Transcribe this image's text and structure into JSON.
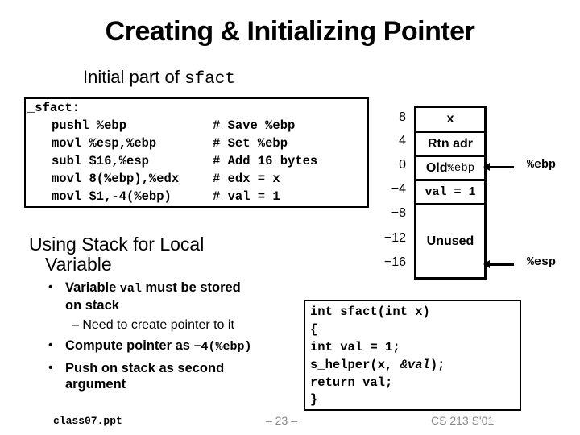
{
  "slide": {
    "title": "Creating & Initializing Pointer",
    "subtitle_prefix": "Initial part of ",
    "subtitle_code": "sfact"
  },
  "assembly": {
    "label": "_sfact:",
    "lines": [
      {
        "instr": "pushl %ebp",
        "comment": "# Save %ebp"
      },
      {
        "instr": "movl %esp,%ebp",
        "comment": "# Set %ebp"
      },
      {
        "instr": "subl $16,%esp",
        "comment": "# Add 16 bytes"
      },
      {
        "instr": "movl 8(%ebp),%edx",
        "comment": "# edx = x"
      },
      {
        "instr": "movl $1,-4(%ebp)",
        "comment": "# val = 1"
      }
    ]
  },
  "stack": {
    "offsets": [
      "8",
      "4",
      "0",
      "−4",
      "−8",
      "−12",
      "−16"
    ],
    "cells": [
      {
        "label": "x"
      },
      {
        "label": "Rtn adr"
      },
      {
        "label_prefix": "Old ",
        "label_code": "%ebp"
      },
      {
        "label": "val = 1"
      },
      {
        "label": "Unused"
      }
    ],
    "registers": [
      {
        "name": "%ebp",
        "points_to_offset": "0"
      },
      {
        "name": "%esp",
        "points_to_offset": "-16"
      }
    ]
  },
  "section": {
    "heading_line1": "Using Stack for Local",
    "heading_line2": "Variable",
    "bullets": [
      {
        "dot": "•",
        "text_a": "Variable ",
        "code": "val",
        "text_b": " must be stored",
        "text_c": "on stack"
      },
      {
        "dot": "•",
        "text_a": "Compute pointer as ",
        "code": "−4(%ebp)"
      },
      {
        "dot": "•",
        "text_a": "Push on stack as second",
        "text_c": "argument"
      }
    ],
    "sub_item": "– Need to create pointer to it"
  },
  "c_code": {
    "lines": [
      "int sfact(int x)",
      "{",
      "  int val = 1;",
      "  s_helper(x, ",
      "&val",
      ");",
      "  return val;",
      "}"
    ]
  },
  "footer": {
    "file": "class07.ppt",
    "page": "– 23 –",
    "course": "CS 213 S'01"
  }
}
